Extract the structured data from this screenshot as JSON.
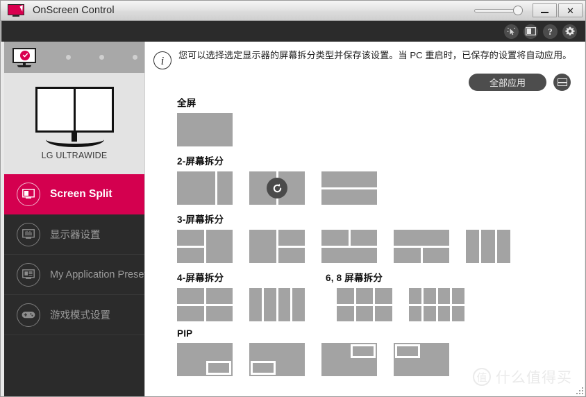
{
  "window": {
    "title": "OnScreen Control",
    "logo_icon": "monitor-cursor-logo-icon",
    "opacity_slider_label": "opacity-slider",
    "minimize_label": "",
    "close_label": "✕"
  },
  "toolbar": {
    "items": [
      {
        "name": "pointer-capture-icon",
        "label": ""
      },
      {
        "name": "screen-split-icon",
        "label": ""
      },
      {
        "name": "help-icon",
        "label": "?"
      },
      {
        "name": "settings-gear-icon",
        "label": ""
      }
    ]
  },
  "sidebar": {
    "monitor_strip": {
      "active_monitor_icon": "monitor-selected-icon",
      "inactive_dots": 3
    },
    "monitor_preview": {
      "icon": "dual-monitor-icon",
      "name": "LG ULTRAWIDE"
    },
    "items": [
      {
        "label": "Screen Split",
        "icon": "screen-split-icon",
        "active": true
      },
      {
        "label": "显示器设置",
        "icon": "monitor-settings-icon",
        "active": false
      },
      {
        "label": "My Application Preset",
        "icon": "application-preset-icon",
        "active": false
      },
      {
        "label": "游戏模式设置",
        "icon": "gamepad-icon",
        "active": false
      }
    ]
  },
  "main": {
    "info_icon": "info-icon",
    "info_text": "您可以选择选定显示器的屏幕拆分类型并保存该设置。当 PC 重启时，已保存的设置将自动应用。",
    "apply_all_label": "全部应用",
    "save_icon": "save-icon",
    "hover_overlay_icon": "rotate-icon",
    "sections": {
      "fullscreen_title": "全屏",
      "two_split_title": "2-屏幕拆分",
      "three_split_title": "3-屏幕拆分",
      "four_split_title": "4-屏幕拆分",
      "six_eight_split_title": "6, 8 屏幕拆分",
      "pip_title": "PIP"
    }
  },
  "watermark": {
    "logo_char": "值",
    "text": "什么值得买"
  },
  "colors": {
    "accent": "#d4004f",
    "toolbar_bg": "#2b2b2b",
    "sidebar_bg": "#2b2b2b",
    "thumb_cell": "#a3a3a3",
    "panel_bg": "#e3e3e3"
  }
}
